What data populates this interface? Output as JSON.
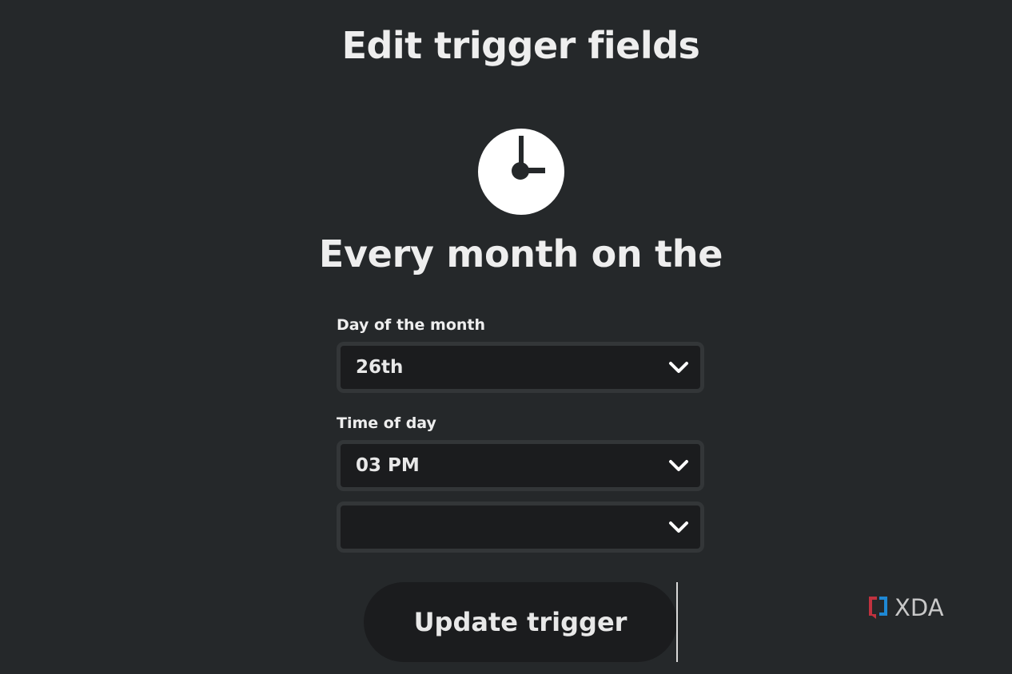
{
  "header": {
    "title": "Edit trigger fields"
  },
  "trigger": {
    "icon": "clock-icon",
    "subtitle": "Every month on the"
  },
  "fields": {
    "day_of_month": {
      "label": "Day of the month",
      "value": "26th"
    },
    "time_of_day": {
      "label": "Time of day",
      "hour_value": "03 PM",
      "minute_value": ""
    }
  },
  "actions": {
    "update_label": "Update trigger"
  },
  "watermark": {
    "text": "XDA"
  },
  "colors": {
    "background": "#25282a",
    "field_background": "#1b1c1e",
    "field_border": "#333638",
    "text": "#eeeeee",
    "logo_red": "#c1323f",
    "logo_blue": "#1e88d4"
  }
}
